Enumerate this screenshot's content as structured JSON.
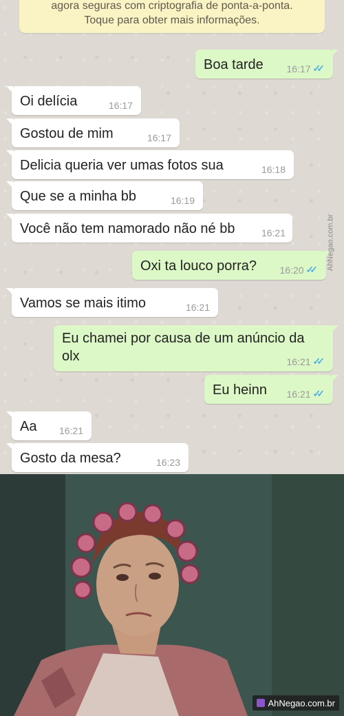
{
  "chat": {
    "encryption_notice": {
      "line1": "agora seguras com criptografia de ponta-a-ponta.",
      "line2": "Toque para obter mais informações."
    },
    "messages": [
      {
        "direction": "out",
        "text": "Boa tarde",
        "time": "16:17",
        "ticks": "read"
      },
      {
        "direction": "in",
        "text": "Oi delícia",
        "time": "16:17"
      },
      {
        "direction": "in",
        "text": "Gostou de mim",
        "time": "16:17"
      },
      {
        "direction": "in",
        "text": "Delicia queria ver umas fotos sua",
        "time": "16:18"
      },
      {
        "direction": "in",
        "text": "Que se a minha bb",
        "time": "16:19"
      },
      {
        "direction": "in",
        "text": "Você não tem namorado não né bb",
        "time": "16:21"
      },
      {
        "direction": "out",
        "text": "Oxi ta louco porra?",
        "time": "16:20",
        "ticks": "read"
      },
      {
        "direction": "in",
        "text": "Vamos se mais itimo",
        "time": "16:21"
      },
      {
        "direction": "out",
        "text": "Eu chamei por causa de um anúncio da olx",
        "time": "16:21",
        "ticks": "read"
      },
      {
        "direction": "out",
        "text": "Eu heinn",
        "time": "16:21",
        "ticks": "read"
      },
      {
        "direction": "in",
        "text": "Aa",
        "time": "16:21"
      },
      {
        "direction": "in",
        "text": "Gosto da mesa?",
        "time": "16:23"
      }
    ],
    "tick_glyph": "✓✓",
    "colors": {
      "incoming": "#ffffff",
      "outgoing": "#dcf8c6",
      "read_ticks": "#4fb3e8",
      "notice": "#faf3c4"
    }
  },
  "watermarks": {
    "side": "AhNegao.com.br",
    "bottom": "AhNegao.com.br"
  },
  "reaction_image": {
    "icon": "reaction-meme-image"
  }
}
